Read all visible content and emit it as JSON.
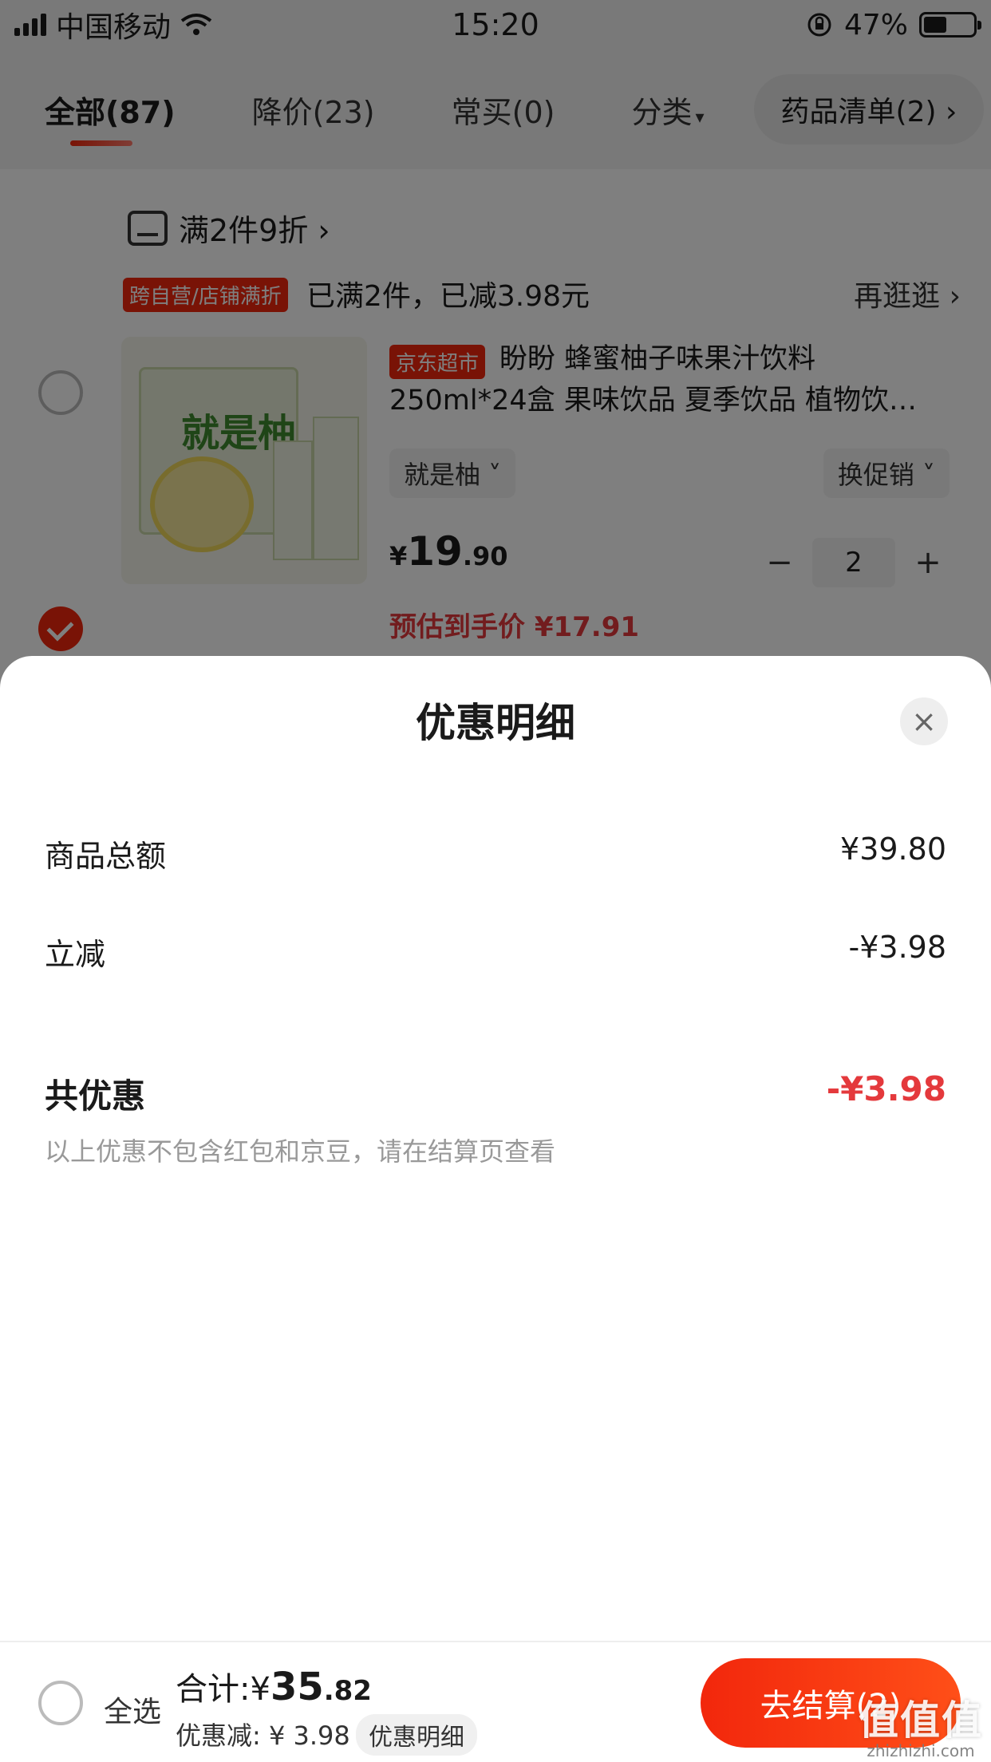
{
  "status_bar": {
    "carrier": "中国移动",
    "time": "15:20",
    "battery_percent": "47%",
    "battery_level": 0.47,
    "icons": [
      "signal-icon",
      "wifi-icon",
      "rotation-lock-icon",
      "battery-icon"
    ]
  },
  "tabs": [
    {
      "label": "全部(87)",
      "active": true
    },
    {
      "label": "降价(23)",
      "active": false
    },
    {
      "label": "常买(0)",
      "active": false
    },
    {
      "label": "分类",
      "active": false
    }
  ],
  "tab_pill": "药品清单(2) ›",
  "cart": {
    "promo_line": "满2件9折 ›",
    "promo_tag": "跨自营/店铺满折",
    "promo_done": "已满2件，已减3.98元",
    "promo_more": "再逛逛 ›",
    "product": {
      "store_tag": "京东超市",
      "title": "盼盼 蜂蜜柚子味果汁饮料 250ml*24盒 果味饮品 夏季饮品 植物饮…",
      "image_label": "就是柚",
      "spec": "就是柚 ˅",
      "promo_select": "换促销 ˅",
      "price_symbol": "¥",
      "price_int": "19",
      "price_dec": ".90",
      "quantity": "2",
      "minus": "−",
      "plus": "+",
      "estimated_price": "预估到手价 ¥17.91",
      "checked": true
    }
  },
  "sheet": {
    "title": "优惠明细",
    "close": "×",
    "rows": [
      {
        "label": "商品总额",
        "value": "¥39.80"
      },
      {
        "label": "立减",
        "value": "-¥3.98"
      }
    ],
    "total": {
      "label": "共优惠",
      "value": "-¥3.98"
    },
    "note": "以上优惠不包含红包和京豆，请在结算页查看"
  },
  "bottom_bar": {
    "select_all": "全选",
    "total_label": "合计:¥",
    "total_int": "35",
    "total_dec": ".82",
    "discount": "优惠减: ¥ 3.98",
    "detail_chip": "优惠明细",
    "checkout": "去结算(2)"
  },
  "watermark": {
    "text": "值值值",
    "site": "zhizhizhi.com"
  },
  "colors": {
    "accent": "#f2270c",
    "price_red": "#e4393c",
    "overlay": "rgba(0,0,0,0.5)"
  }
}
